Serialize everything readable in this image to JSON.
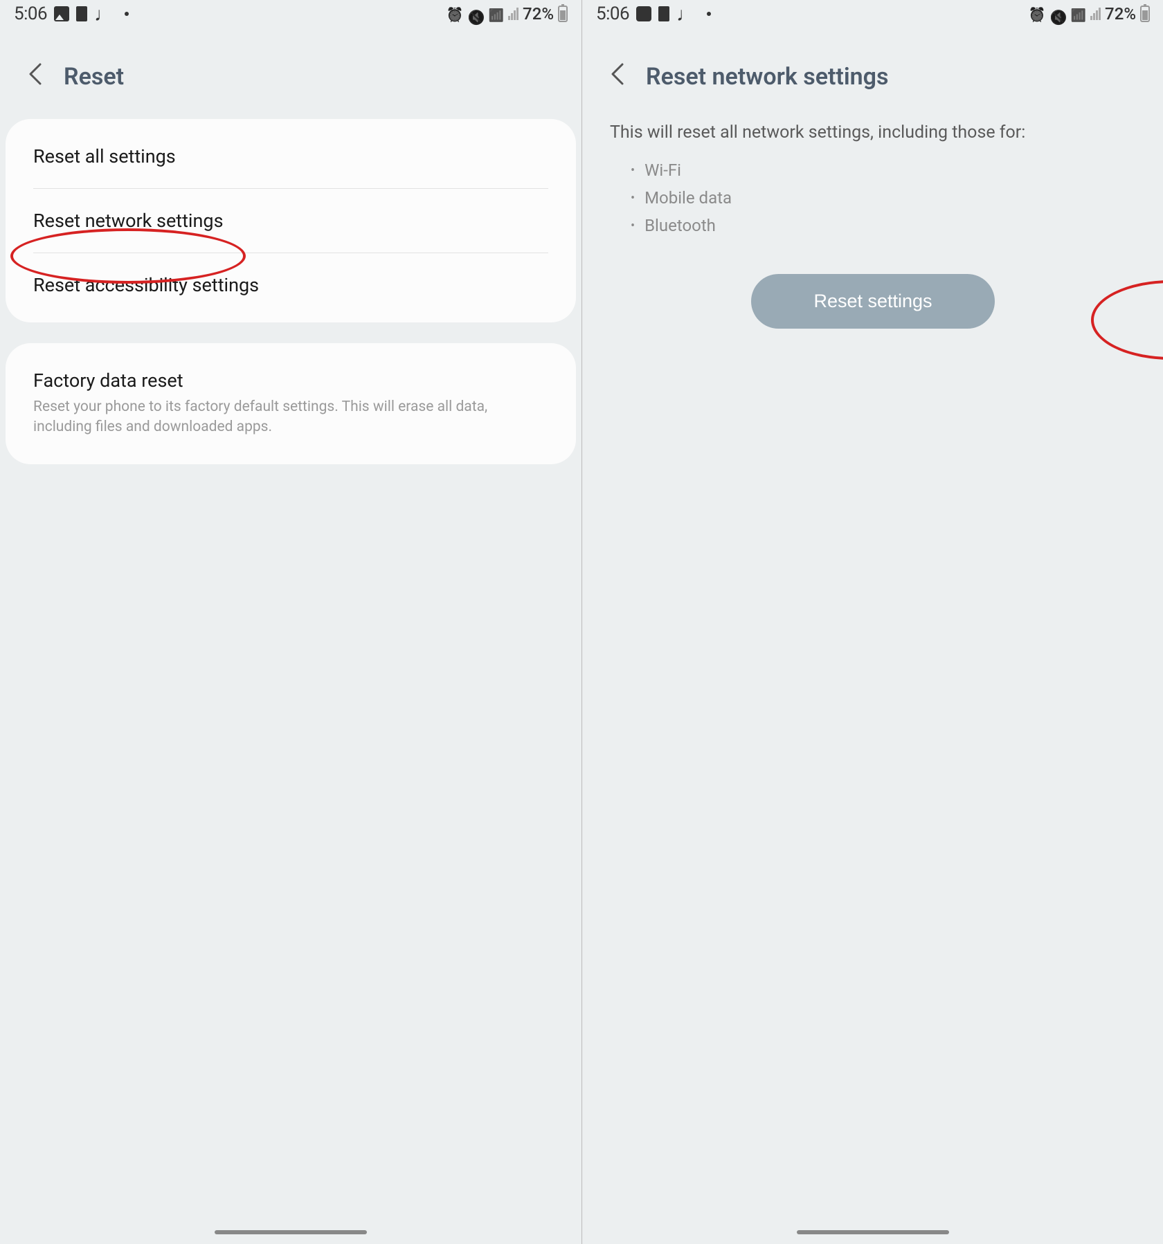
{
  "status": {
    "time": "5:06",
    "battery_pct": "72%"
  },
  "left_screen": {
    "title": "Reset",
    "items": [
      {
        "label": "Reset all settings"
      },
      {
        "label": "Reset network settings"
      },
      {
        "label": "Reset accessibility settings"
      }
    ],
    "factory": {
      "title": "Factory data reset",
      "desc": "Reset your phone to its factory default settings. This will erase all data, including files and downloaded apps."
    }
  },
  "right_screen": {
    "title": "Reset network settings",
    "intro": "This will reset all network settings, including those for:",
    "bullets": [
      "Wi-Fi",
      "Mobile data",
      "Bluetooth"
    ],
    "button_label": "Reset settings"
  }
}
